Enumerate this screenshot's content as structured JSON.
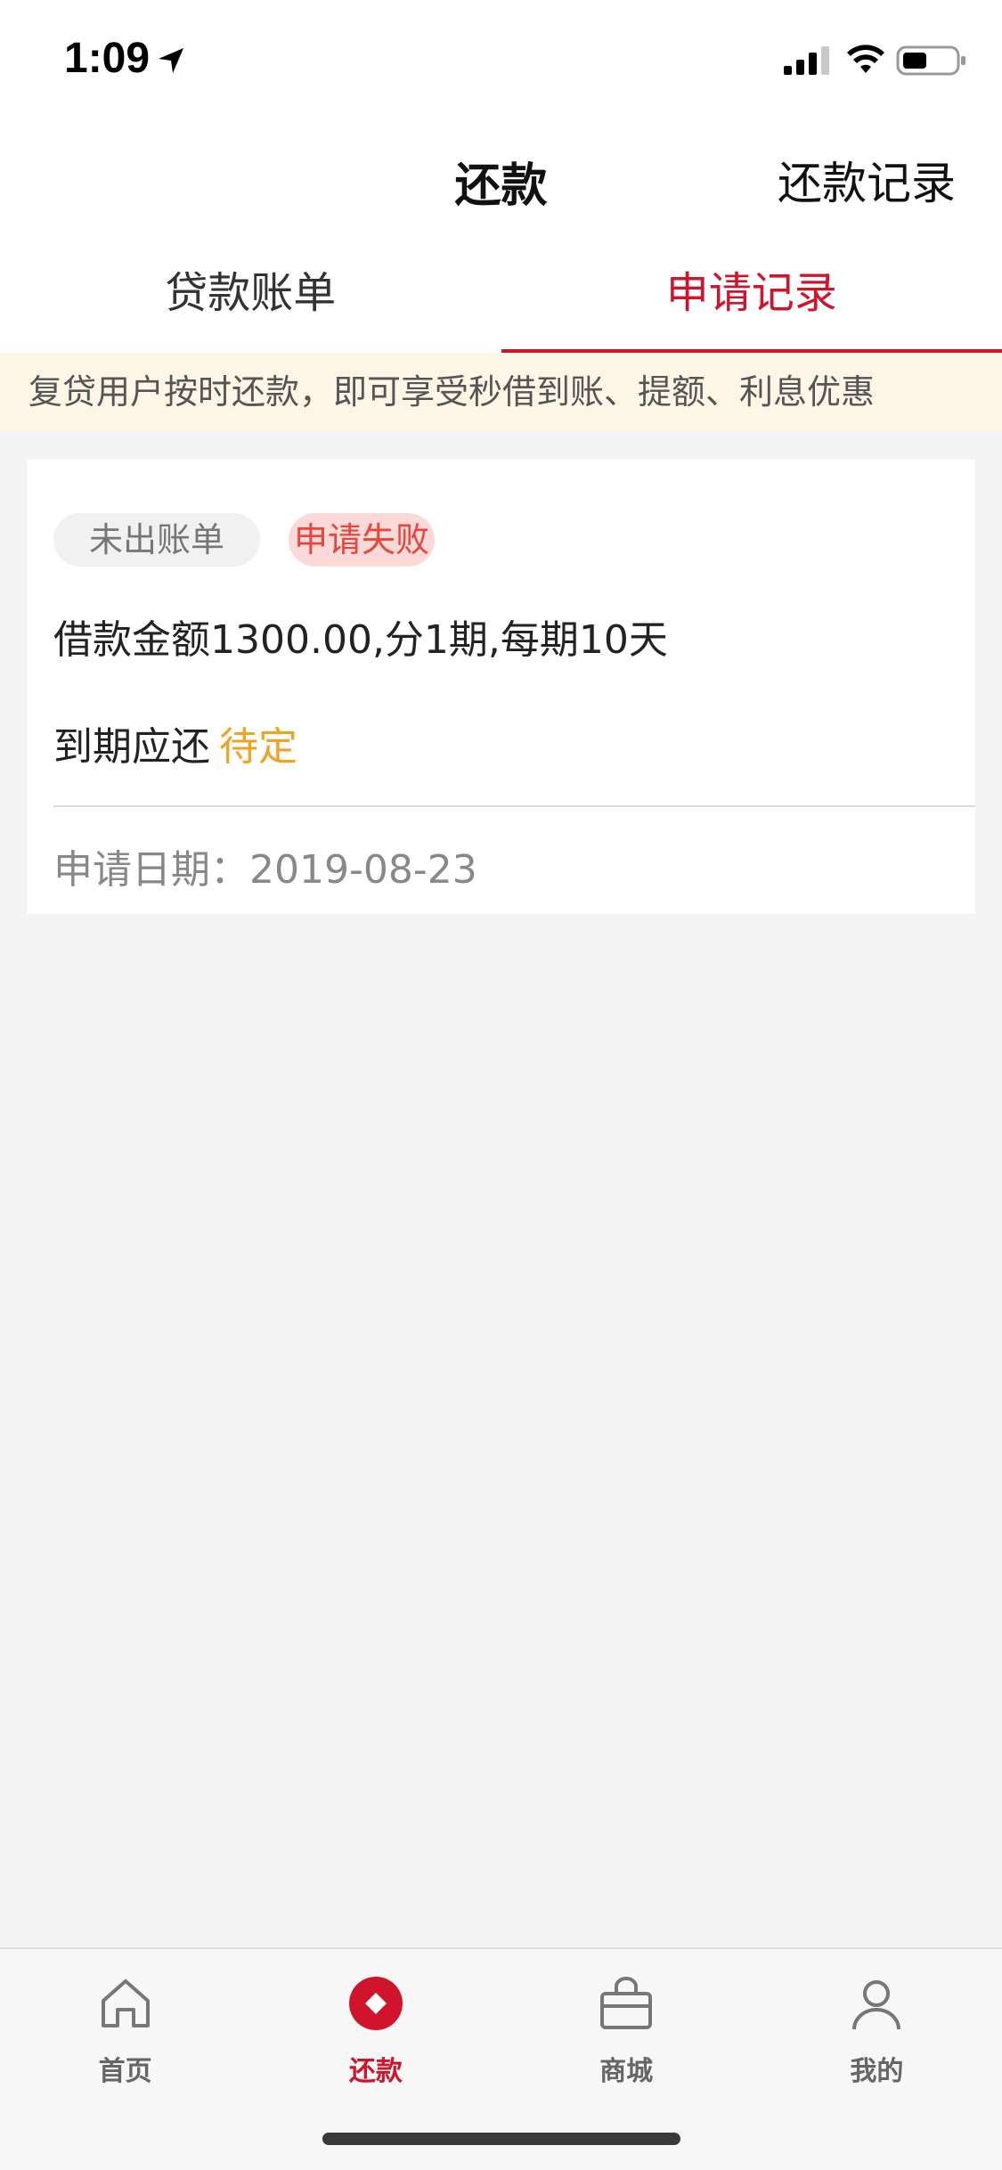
{
  "status_bar": {
    "time": "1:09"
  },
  "nav": {
    "title": "还款",
    "right_action": "还款记录"
  },
  "tabs": [
    {
      "label": "贷款账单",
      "active": false
    },
    {
      "label": "申请记录",
      "active": true
    }
  ],
  "notice": "复贷用户按时还款，即可享受秒借到账、提额、利息优惠",
  "record": {
    "tag_bill": "未出账单",
    "tag_status": "申请失败",
    "loan_info": "借款金额1300.00,分1期,每期10天",
    "due_label": "到期应还",
    "due_value": "待定",
    "date_text": "申请日期：2019-08-23"
  },
  "bottom_tabs": [
    {
      "label": "首页",
      "icon": "home-icon",
      "active": false
    },
    {
      "label": "还款",
      "icon": "repay-icon",
      "active": true
    },
    {
      "label": "商城",
      "icon": "shop-bag-icon",
      "active": false
    },
    {
      "label": "我的",
      "icon": "profile-icon",
      "active": false
    }
  ],
  "colors": {
    "accent": "#d0142c",
    "pending": "#f0a323",
    "notice_bg": "#fdf6e6",
    "fail_tag_bg": "#fbd9d9",
    "fail_tag_text": "#e8453c"
  }
}
